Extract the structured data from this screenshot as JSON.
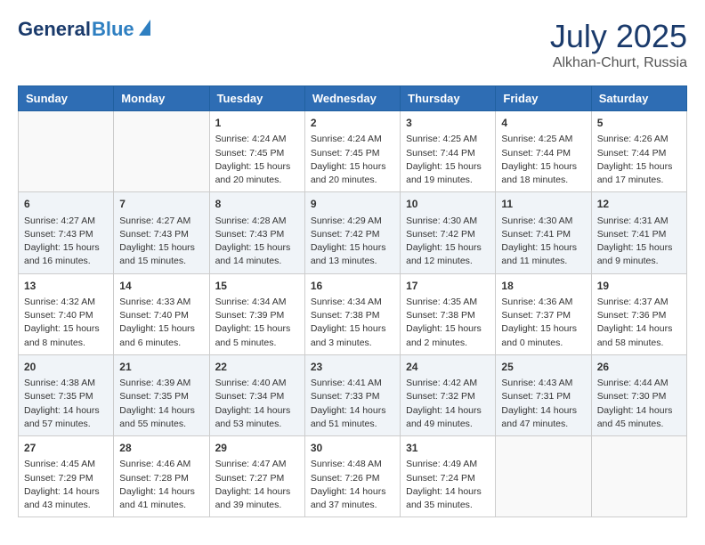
{
  "header": {
    "logo_general": "General",
    "logo_blue": "Blue",
    "month": "July 2025",
    "location": "Alkhan-Churt, Russia"
  },
  "days_of_week": [
    "Sunday",
    "Monday",
    "Tuesday",
    "Wednesday",
    "Thursday",
    "Friday",
    "Saturday"
  ],
  "weeks": [
    [
      {
        "day": "",
        "sunrise": "",
        "sunset": "",
        "daylight": ""
      },
      {
        "day": "",
        "sunrise": "",
        "sunset": "",
        "daylight": ""
      },
      {
        "day": "1",
        "sunrise": "Sunrise: 4:24 AM",
        "sunset": "Sunset: 7:45 PM",
        "daylight": "Daylight: 15 hours and 20 minutes."
      },
      {
        "day": "2",
        "sunrise": "Sunrise: 4:24 AM",
        "sunset": "Sunset: 7:45 PM",
        "daylight": "Daylight: 15 hours and 20 minutes."
      },
      {
        "day": "3",
        "sunrise": "Sunrise: 4:25 AM",
        "sunset": "Sunset: 7:44 PM",
        "daylight": "Daylight: 15 hours and 19 minutes."
      },
      {
        "day": "4",
        "sunrise": "Sunrise: 4:25 AM",
        "sunset": "Sunset: 7:44 PM",
        "daylight": "Daylight: 15 hours and 18 minutes."
      },
      {
        "day": "5",
        "sunrise": "Sunrise: 4:26 AM",
        "sunset": "Sunset: 7:44 PM",
        "daylight": "Daylight: 15 hours and 17 minutes."
      }
    ],
    [
      {
        "day": "6",
        "sunrise": "Sunrise: 4:27 AM",
        "sunset": "Sunset: 7:43 PM",
        "daylight": "Daylight: 15 hours and 16 minutes."
      },
      {
        "day": "7",
        "sunrise": "Sunrise: 4:27 AM",
        "sunset": "Sunset: 7:43 PM",
        "daylight": "Daylight: 15 hours and 15 minutes."
      },
      {
        "day": "8",
        "sunrise": "Sunrise: 4:28 AM",
        "sunset": "Sunset: 7:43 PM",
        "daylight": "Daylight: 15 hours and 14 minutes."
      },
      {
        "day": "9",
        "sunrise": "Sunrise: 4:29 AM",
        "sunset": "Sunset: 7:42 PM",
        "daylight": "Daylight: 15 hours and 13 minutes."
      },
      {
        "day": "10",
        "sunrise": "Sunrise: 4:30 AM",
        "sunset": "Sunset: 7:42 PM",
        "daylight": "Daylight: 15 hours and 12 minutes."
      },
      {
        "day": "11",
        "sunrise": "Sunrise: 4:30 AM",
        "sunset": "Sunset: 7:41 PM",
        "daylight": "Daylight: 15 hours and 11 minutes."
      },
      {
        "day": "12",
        "sunrise": "Sunrise: 4:31 AM",
        "sunset": "Sunset: 7:41 PM",
        "daylight": "Daylight: 15 hours and 9 minutes."
      }
    ],
    [
      {
        "day": "13",
        "sunrise": "Sunrise: 4:32 AM",
        "sunset": "Sunset: 7:40 PM",
        "daylight": "Daylight: 15 hours and 8 minutes."
      },
      {
        "day": "14",
        "sunrise": "Sunrise: 4:33 AM",
        "sunset": "Sunset: 7:40 PM",
        "daylight": "Daylight: 15 hours and 6 minutes."
      },
      {
        "day": "15",
        "sunrise": "Sunrise: 4:34 AM",
        "sunset": "Sunset: 7:39 PM",
        "daylight": "Daylight: 15 hours and 5 minutes."
      },
      {
        "day": "16",
        "sunrise": "Sunrise: 4:34 AM",
        "sunset": "Sunset: 7:38 PM",
        "daylight": "Daylight: 15 hours and 3 minutes."
      },
      {
        "day": "17",
        "sunrise": "Sunrise: 4:35 AM",
        "sunset": "Sunset: 7:38 PM",
        "daylight": "Daylight: 15 hours and 2 minutes."
      },
      {
        "day": "18",
        "sunrise": "Sunrise: 4:36 AM",
        "sunset": "Sunset: 7:37 PM",
        "daylight": "Daylight: 15 hours and 0 minutes."
      },
      {
        "day": "19",
        "sunrise": "Sunrise: 4:37 AM",
        "sunset": "Sunset: 7:36 PM",
        "daylight": "Daylight: 14 hours and 58 minutes."
      }
    ],
    [
      {
        "day": "20",
        "sunrise": "Sunrise: 4:38 AM",
        "sunset": "Sunset: 7:35 PM",
        "daylight": "Daylight: 14 hours and 57 minutes."
      },
      {
        "day": "21",
        "sunrise": "Sunrise: 4:39 AM",
        "sunset": "Sunset: 7:35 PM",
        "daylight": "Daylight: 14 hours and 55 minutes."
      },
      {
        "day": "22",
        "sunrise": "Sunrise: 4:40 AM",
        "sunset": "Sunset: 7:34 PM",
        "daylight": "Daylight: 14 hours and 53 minutes."
      },
      {
        "day": "23",
        "sunrise": "Sunrise: 4:41 AM",
        "sunset": "Sunset: 7:33 PM",
        "daylight": "Daylight: 14 hours and 51 minutes."
      },
      {
        "day": "24",
        "sunrise": "Sunrise: 4:42 AM",
        "sunset": "Sunset: 7:32 PM",
        "daylight": "Daylight: 14 hours and 49 minutes."
      },
      {
        "day": "25",
        "sunrise": "Sunrise: 4:43 AM",
        "sunset": "Sunset: 7:31 PM",
        "daylight": "Daylight: 14 hours and 47 minutes."
      },
      {
        "day": "26",
        "sunrise": "Sunrise: 4:44 AM",
        "sunset": "Sunset: 7:30 PM",
        "daylight": "Daylight: 14 hours and 45 minutes."
      }
    ],
    [
      {
        "day": "27",
        "sunrise": "Sunrise: 4:45 AM",
        "sunset": "Sunset: 7:29 PM",
        "daylight": "Daylight: 14 hours and 43 minutes."
      },
      {
        "day": "28",
        "sunrise": "Sunrise: 4:46 AM",
        "sunset": "Sunset: 7:28 PM",
        "daylight": "Daylight: 14 hours and 41 minutes."
      },
      {
        "day": "29",
        "sunrise": "Sunrise: 4:47 AM",
        "sunset": "Sunset: 7:27 PM",
        "daylight": "Daylight: 14 hours and 39 minutes."
      },
      {
        "day": "30",
        "sunrise": "Sunrise: 4:48 AM",
        "sunset": "Sunset: 7:26 PM",
        "daylight": "Daylight: 14 hours and 37 minutes."
      },
      {
        "day": "31",
        "sunrise": "Sunrise: 4:49 AM",
        "sunset": "Sunset: 7:24 PM",
        "daylight": "Daylight: 14 hours and 35 minutes."
      },
      {
        "day": "",
        "sunrise": "",
        "sunset": "",
        "daylight": ""
      },
      {
        "day": "",
        "sunrise": "",
        "sunset": "",
        "daylight": ""
      }
    ]
  ]
}
